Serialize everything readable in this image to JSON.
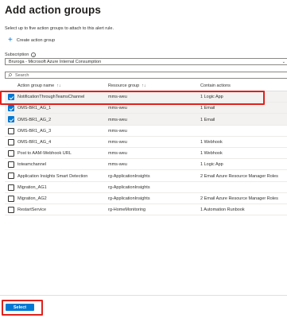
{
  "page": {
    "title": "Add action groups",
    "subtitle": "Select up to five action groups to attach to this alert rule."
  },
  "create": {
    "label": "Create action group"
  },
  "subscription": {
    "label": "Subscription",
    "value": "Bruroga - Microsoft Azure Internal Consumption"
  },
  "search": {
    "placeholder": "Search",
    "value": ""
  },
  "table": {
    "columns": [
      "Action group name",
      "Resource group",
      "Contain actions"
    ],
    "sort_indicator": "↑↓",
    "rows": [
      {
        "name": "NotificationThroughTeamsChannel",
        "resource_group": "mms-weu",
        "actions": "1 Logic App",
        "checked": true
      },
      {
        "name": "OMS-BR1_AG_1",
        "resource_group": "mms-weu",
        "actions": "1 Email",
        "checked": true
      },
      {
        "name": "OMS-BR1_AG_2",
        "resource_group": "mms-weu",
        "actions": "1 Email",
        "checked": true
      },
      {
        "name": "OMS-BR1_AG_3",
        "resource_group": "mms-weu",
        "actions": "",
        "checked": false
      },
      {
        "name": "OMS-BR1_AG_4",
        "resource_group": "mms-weu",
        "actions": "1 Webhook",
        "checked": false
      },
      {
        "name": "Post to AAM-Webhook URL",
        "resource_group": "mms-weu",
        "actions": "1 Webhook",
        "checked": false
      },
      {
        "name": "toteamchannel",
        "resource_group": "mms-weu",
        "actions": "1 Logic App",
        "checked": false
      },
      {
        "name": "Application Insights Smart Detection",
        "resource_group": "rg-ApplicationInsights",
        "actions": "2 Email Azure Resource Manager Roles",
        "checked": false
      },
      {
        "name": "Migration_AG1",
        "resource_group": "rg-ApplicationInsights",
        "actions": "",
        "checked": false
      },
      {
        "name": "Migration_AG2",
        "resource_group": "rg-ApplicationInsights",
        "actions": "2 Email Azure Resource Manager Roles",
        "checked": false
      },
      {
        "name": "RestartService",
        "resource_group": "rg-HomeMonitoring",
        "actions": "1 Automation Runbook",
        "checked": false
      }
    ]
  },
  "footer": {
    "select_label": "Select"
  },
  "colors": {
    "accent": "#0078d4",
    "highlight": "#e0211c"
  }
}
